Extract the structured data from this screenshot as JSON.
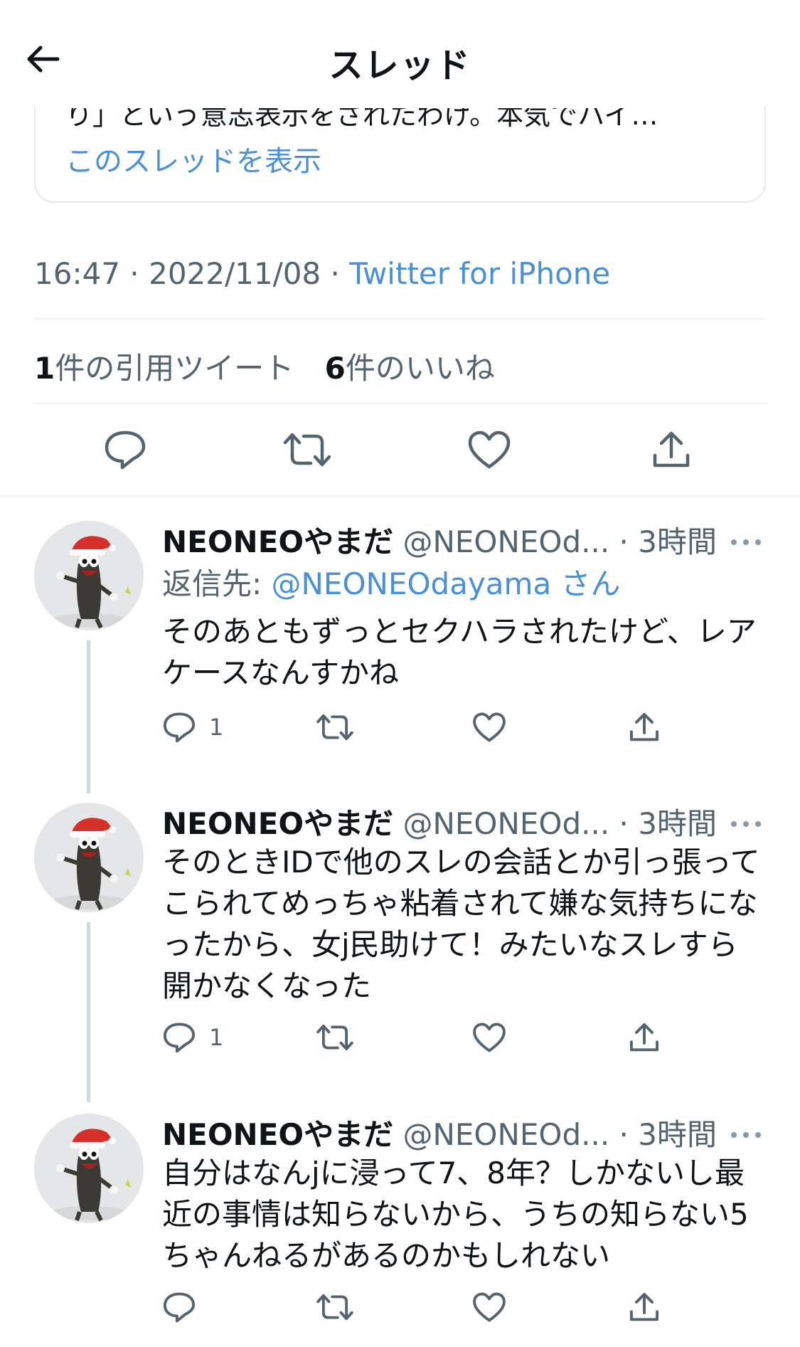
{
  "header": {
    "title": "スレッド"
  },
  "quote": {
    "text": "り」という意志表示をされたわけ。本気でハイ…",
    "show_thread": "このスレッドを表示"
  },
  "meta": {
    "time": "16:47",
    "sep1": " · ",
    "date": "2022/11/08",
    "sep2": " · ",
    "source": "Twitter for iPhone"
  },
  "stats": {
    "quotes_count": "1",
    "quotes_label": "件の引用ツイート",
    "likes_count": "6",
    "likes_label": "件のいいね"
  },
  "replies": [
    {
      "name": "NEONEOやまだ",
      "handle": "@NEONEOd...",
      "time": " · 3時間",
      "reply_prefix": "返信先: ",
      "reply_to": "@NEONEOdayama",
      "reply_suffix": "さん",
      "body": "そのあともずっとセクハラされたけど、レアケースなんすかね",
      "reply_count": "1"
    },
    {
      "name": "NEONEOやまだ",
      "handle": "@NEONEOd...",
      "time": " · 3時間",
      "body": "そのときIDで他のスレの会話とか引っ張ってこられてめっちゃ粘着されて嫌な気持ちになったから、女j民助けて！みたいなスレすら開かなくなった",
      "reply_count": "1"
    },
    {
      "name": "NEONEOやまだ",
      "handle": "@NEONEOd...",
      "time": " · 3時間",
      "body": "自分はなんjに浸って7、8年？しかないし最近の事情は知らないから、うちの知らない5ちゃんねるがあるのかもしれない",
      "reply_count": ""
    }
  ],
  "icons": [
    "back-arrow-icon",
    "reply-icon",
    "retweet-icon",
    "like-icon",
    "share-icon",
    "more-icon"
  ],
  "colors": {
    "link": "#4a90d9",
    "text": "#0f1419",
    "muted": "#536471",
    "divider": "#eff3f4"
  }
}
